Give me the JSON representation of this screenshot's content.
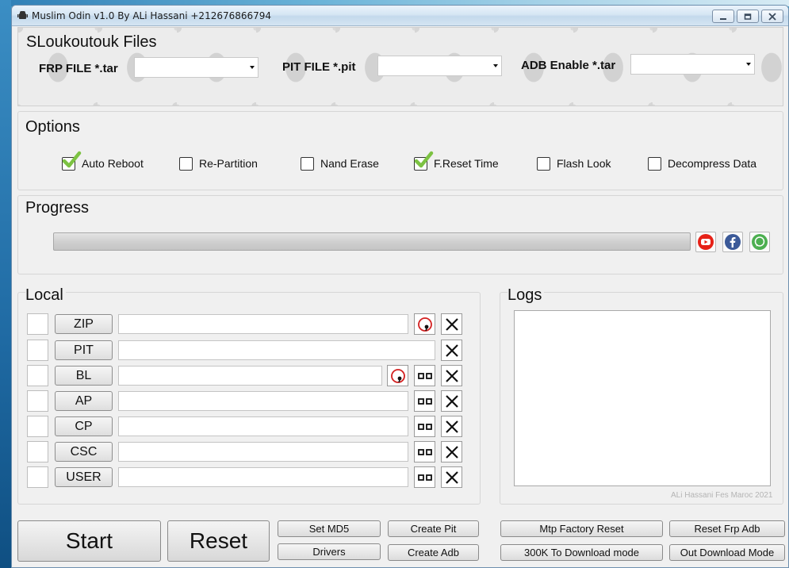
{
  "window": {
    "title": "Muslim Odin v1.0 By ALi Hassani +212676866794"
  },
  "files": {
    "title": "SLoukoutouk Files",
    "frp_label": "FRP FILE *.tar",
    "frp_value": "",
    "pit_label": "PIT FILE *.pit",
    "pit_value": "",
    "adb_label": "ADB Enable *.tar",
    "adb_value": ""
  },
  "options": {
    "title": "Options",
    "items": [
      {
        "label": "Auto Reboot",
        "checked": true
      },
      {
        "label": "Re-Partition",
        "checked": false
      },
      {
        "label": "Nand Erase",
        "checked": false
      },
      {
        "label": "F.Reset Time",
        "checked": true
      },
      {
        "label": "Flash Look",
        "checked": false
      },
      {
        "label": "Decompress Data",
        "checked": false
      }
    ]
  },
  "progress": {
    "title": "Progress",
    "value_percent": 0,
    "social_icons": [
      "youtube-icon",
      "facebook-icon",
      "whatsapp-icon"
    ]
  },
  "local": {
    "title": "Local",
    "rows": [
      {
        "label": "ZIP",
        "checked": false,
        "path": ""
      },
      {
        "label": "PIT",
        "checked": false,
        "path": ""
      },
      {
        "label": "BL",
        "checked": false,
        "path": ""
      },
      {
        "label": "AP",
        "checked": false,
        "path": ""
      },
      {
        "label": "CP",
        "checked": false,
        "path": ""
      },
      {
        "label": "CSC",
        "checked": false,
        "path": ""
      },
      {
        "label": "USER",
        "checked": false,
        "path": ""
      }
    ]
  },
  "logs": {
    "title": "Logs",
    "content": "",
    "credit": "ALi Hassani Fes Maroc 2021"
  },
  "actions": {
    "start": "Start",
    "reset": "Reset",
    "set_md5": "Set MD5",
    "drivers": "Drivers",
    "create_pit": "Create Pit",
    "create_adb": "Create Adb",
    "mtp_factory_reset": "Mtp Factory Reset",
    "download_mode_300k": "300K To Download mode",
    "reset_frp_adb": "Reset Frp Adb",
    "out_download_mode": "Out Download Mode"
  },
  "colors": {
    "check_green": "#7cc242",
    "youtube_red": "#e62117",
    "facebook_blue": "#3b5998",
    "whatsapp_green": "#4caf50"
  }
}
